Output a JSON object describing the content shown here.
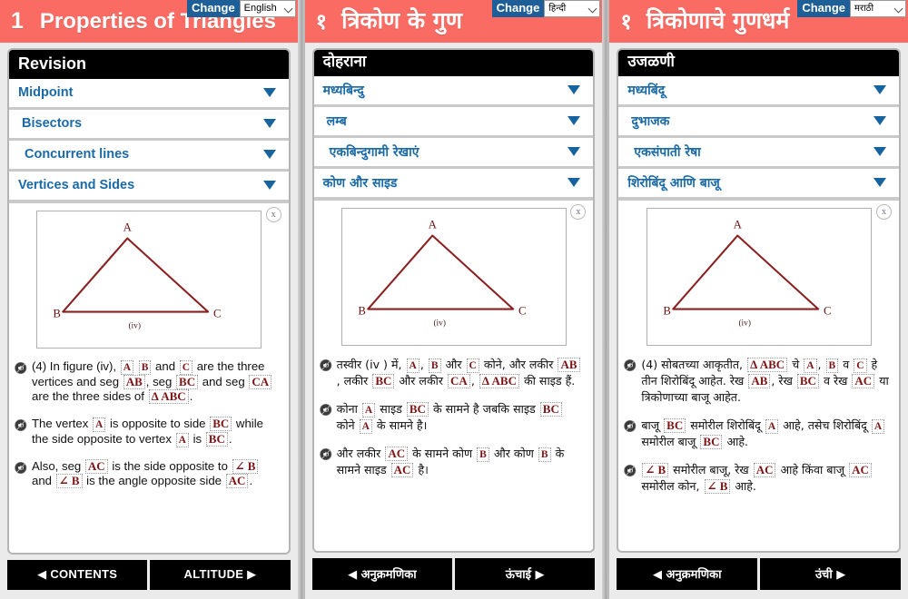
{
  "colors": {
    "header_bg": "#fa6b63",
    "accent_blue": "#1a6aa8",
    "change_btn_bg": "#1d5f96",
    "math_red": "#7d1414",
    "triangle_stroke": "#8b2020",
    "panel_bg": "#ebebeb"
  },
  "panels": [
    {
      "lang_code": "en",
      "header": {
        "number": "1",
        "title": "Properties of Triangles",
        "change_label": "Change",
        "language_selected": "English"
      },
      "card_title": "Revision",
      "accordion": [
        {
          "label": "Midpoint",
          "chevron": "chevron-down-icon"
        },
        {
          "label": "Bisectors",
          "chevron": "chevron-down-icon"
        },
        {
          "label": "Concurrent lines",
          "chevron": "chevron-down-icon"
        },
        {
          "label": "Vertices and Sides",
          "chevron": "chevron-down-icon"
        }
      ],
      "figure": {
        "close_label": "x",
        "vertex_a": "A",
        "vertex_b": "B",
        "vertex_c": "C",
        "caption": "(iv)"
      },
      "paragraphs": [
        [
          {
            "t": "text",
            "v": "(4) In figure (iv), "
          },
          {
            "t": "math",
            "v": "A"
          },
          {
            "t": "text",
            "v": " "
          },
          {
            "t": "math",
            "v": "B"
          },
          {
            "t": "text",
            "v": " and "
          },
          {
            "t": "math",
            "v": "C"
          },
          {
            "t": "text",
            "v": " are the three vertices and seg "
          },
          {
            "t": "math",
            "v": "AB"
          },
          {
            "t": "text",
            "v": ", seg "
          },
          {
            "t": "math",
            "v": "BC"
          },
          {
            "t": "text",
            "v": " and seg "
          },
          {
            "t": "math",
            "v": "CA"
          },
          {
            "t": "text",
            "v": " are the three sides of "
          },
          {
            "t": "math",
            "v": "Δ ABC"
          },
          {
            "t": "text",
            "v": "."
          }
        ],
        [
          {
            "t": "text",
            "v": "The vertex "
          },
          {
            "t": "math",
            "v": "A"
          },
          {
            "t": "text",
            "v": " is opposite to side "
          },
          {
            "t": "math",
            "v": "BC"
          },
          {
            "t": "text",
            "v": " while the side opposite to vertex "
          },
          {
            "t": "math",
            "v": "A"
          },
          {
            "t": "text",
            "v": " is "
          },
          {
            "t": "math",
            "v": "BC"
          },
          {
            "t": "text",
            "v": "."
          }
        ],
        [
          {
            "t": "text",
            "v": "Also, seg "
          },
          {
            "t": "math",
            "v": "AC"
          },
          {
            "t": "text",
            "v": " is the side opposite to "
          },
          {
            "t": "math",
            "v": "∠ B"
          },
          {
            "t": "text",
            "v": " and "
          },
          {
            "t": "math",
            "v": "∠ B"
          },
          {
            "t": "text",
            "v": " is the angle opposite side "
          },
          {
            "t": "math",
            "v": "AC"
          },
          {
            "t": "text",
            "v": "."
          }
        ]
      ],
      "nav": {
        "prev": "◀ CONTENTS",
        "next": "ALTITUDE ▶"
      }
    },
    {
      "lang_code": "hi",
      "header": {
        "number": "१",
        "title": "त्रिकोण के गुण",
        "change_label": "Change",
        "language_selected": "हिन्दी"
      },
      "card_title": "दोहराना",
      "accordion": [
        {
          "label": "मध्यबिन्दु",
          "chevron": "chevron-down-icon"
        },
        {
          "label": "लम्ब",
          "chevron": "chevron-down-icon"
        },
        {
          "label": "एकबिन्दुगामी रेखाएं",
          "chevron": "chevron-down-icon"
        },
        {
          "label": "कोण और साइड",
          "chevron": "chevron-down-icon"
        }
      ],
      "figure": {
        "close_label": "x",
        "vertex_a": "A",
        "vertex_b": "B",
        "vertex_c": "C",
        "caption": "(iv)"
      },
      "paragraphs": [
        [
          {
            "t": "text",
            "v": "तस्वीर (iv ) में, "
          },
          {
            "t": "math",
            "v": "A"
          },
          {
            "t": "text",
            "v": ", "
          },
          {
            "t": "math",
            "v": "B"
          },
          {
            "t": "text",
            "v": " और "
          },
          {
            "t": "math",
            "v": "C"
          },
          {
            "t": "text",
            "v": " कोने, और लकीर "
          },
          {
            "t": "math",
            "v": "AB"
          },
          {
            "t": "text",
            "v": ", लकीर "
          },
          {
            "t": "math",
            "v": "BC"
          },
          {
            "t": "text",
            "v": " और लकीर "
          },
          {
            "t": "math",
            "v": "CA"
          },
          {
            "t": "text",
            "v": ", "
          },
          {
            "t": "math",
            "v": "Δ ABC"
          },
          {
            "t": "text",
            "v": " की साइड हैं."
          }
        ],
        [
          {
            "t": "text",
            "v": "कोना "
          },
          {
            "t": "math",
            "v": "A"
          },
          {
            "t": "text",
            "v": " साइड "
          },
          {
            "t": "math",
            "v": "BC"
          },
          {
            "t": "text",
            "v": " के सामने है जबकि साइड "
          },
          {
            "t": "math",
            "v": "BC"
          },
          {
            "t": "text",
            "v": " कोने "
          },
          {
            "t": "math",
            "v": "A"
          },
          {
            "t": "text",
            "v": " के सामने है।"
          }
        ],
        [
          {
            "t": "text",
            "v": "और लकीर "
          },
          {
            "t": "math",
            "v": "AC"
          },
          {
            "t": "text",
            "v": " के सामने कोण "
          },
          {
            "t": "math",
            "v": "B"
          },
          {
            "t": "text",
            "v": " और कोण "
          },
          {
            "t": "math",
            "v": "B"
          },
          {
            "t": "text",
            "v": " के सामने साइड "
          },
          {
            "t": "math",
            "v": "AC"
          },
          {
            "t": "text",
            "v": " है।"
          }
        ]
      ],
      "nav": {
        "prev": "◀ अनुक्रमणिका",
        "next": "ऊंचाई ▶"
      }
    },
    {
      "lang_code": "mr",
      "header": {
        "number": "१",
        "title": "त्रिकोणाचे गुणधर्म",
        "change_label": "Change",
        "language_selected": "मराठी"
      },
      "card_title": "उजळणी",
      "accordion": [
        {
          "label": "मध्यबिंदू",
          "chevron": "chevron-down-icon"
        },
        {
          "label": "दुभाजक",
          "chevron": "chevron-down-icon"
        },
        {
          "label": "एकसंपाती रेषा",
          "chevron": "chevron-down-icon"
        },
        {
          "label": "शिरोबिंदू आणि बाजू",
          "chevron": "chevron-down-icon"
        }
      ],
      "figure": {
        "close_label": "x",
        "vertex_a": "A",
        "vertex_b": "B",
        "vertex_c": "C",
        "caption": "(iv)"
      },
      "paragraphs": [
        [
          {
            "t": "text",
            "v": "(4) सोबतच्या आकृतीत, "
          },
          {
            "t": "math",
            "v": "Δ ABC"
          },
          {
            "t": "text",
            "v": " चे "
          },
          {
            "t": "math",
            "v": "A"
          },
          {
            "t": "text",
            "v": ", "
          },
          {
            "t": "math",
            "v": "B"
          },
          {
            "t": "text",
            "v": " व "
          },
          {
            "t": "math",
            "v": "C"
          },
          {
            "t": "text",
            "v": " हे तीन शिरोबिंदू आहेत. रेख "
          },
          {
            "t": "math",
            "v": "AB"
          },
          {
            "t": "text",
            "v": ", रेख "
          },
          {
            "t": "math",
            "v": "BC"
          },
          {
            "t": "text",
            "v": " व रेख "
          },
          {
            "t": "math",
            "v": "AC"
          },
          {
            "t": "text",
            "v": " या त्रिकोणाच्या बाजू आहेत."
          }
        ],
        [
          {
            "t": "text",
            "v": "बाजू "
          },
          {
            "t": "math",
            "v": "BC"
          },
          {
            "t": "text",
            "v": " समोरील शिरोबिंदू "
          },
          {
            "t": "math",
            "v": "A"
          },
          {
            "t": "text",
            "v": " आहे, तसेच शिरोबिंदू "
          },
          {
            "t": "math",
            "v": "A"
          },
          {
            "t": "text",
            "v": " समोरील बाजू "
          },
          {
            "t": "math",
            "v": "BC"
          },
          {
            "t": "text",
            "v": " आहे."
          }
        ],
        [
          {
            "t": "math",
            "v": "∠ B"
          },
          {
            "t": "text",
            "v": " समोरील बाजू, रेख "
          },
          {
            "t": "math",
            "v": "AC"
          },
          {
            "t": "text",
            "v": " आहे किंवा बाजू "
          },
          {
            "t": "math",
            "v": "AC"
          },
          {
            "t": "text",
            "v": " समोरील कोन, "
          },
          {
            "t": "math",
            "v": "∠ B"
          },
          {
            "t": "text",
            "v": " आहे."
          }
        ]
      ],
      "nav": {
        "prev": "◀ अनुक्रमणिका",
        "next": "उंची ▶"
      }
    }
  ]
}
